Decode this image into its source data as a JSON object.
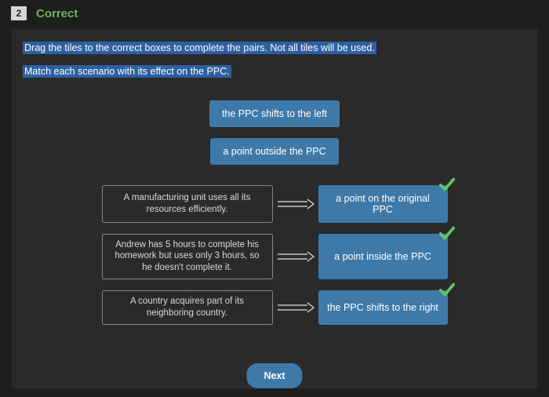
{
  "question_number": "2",
  "status_label": "Correct",
  "instruction_main": "Drag the tiles to the correct boxes to complete the pairs. Not all tiles will be used.",
  "instruction_sub": "Match each scenario with its effect on the PPC.",
  "bank_tiles": [
    "the PPC shifts to the left",
    "a point outside the PPC"
  ],
  "pairs": [
    {
      "scenario": "A manufacturing unit uses all its resources efficiently.",
      "answer": "a point on the original PPC"
    },
    {
      "scenario": "Andrew has 5 hours to complete his homework but uses only 3 hours, so he doesn't complete it.",
      "answer": "a point inside the PPC"
    },
    {
      "scenario": "A country acquires part of its neighboring country.",
      "answer": "the PPC shifts to the right"
    }
  ],
  "next_label": "Next"
}
